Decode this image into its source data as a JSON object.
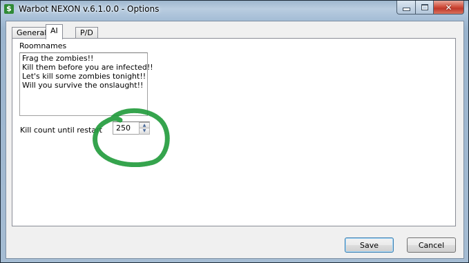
{
  "window": {
    "title": "Warbot NEXON v.6.1.0.0 - Options",
    "icon": "dollar-icon",
    "icon_glyph": "$",
    "controls": {
      "close_glyph": "✕"
    }
  },
  "tabs": [
    {
      "label": "General",
      "selected": false
    },
    {
      "label": "AI",
      "selected": true
    },
    {
      "label": "P/D",
      "selected": false
    }
  ],
  "ai_panel": {
    "roomnames_label": "Roomnames",
    "roomnames": [
      "Frag the zombies!!",
      "Kill them before you are infected!!",
      "Let's kill some zombies tonight!!",
      "Will you survive the onslaught!!"
    ],
    "kill_count_label": "Kill count until restart",
    "kill_count_value": "250",
    "annotation_color": "#1f9a3a"
  },
  "buttons": {
    "save": "Save",
    "cancel": "Cancel"
  }
}
